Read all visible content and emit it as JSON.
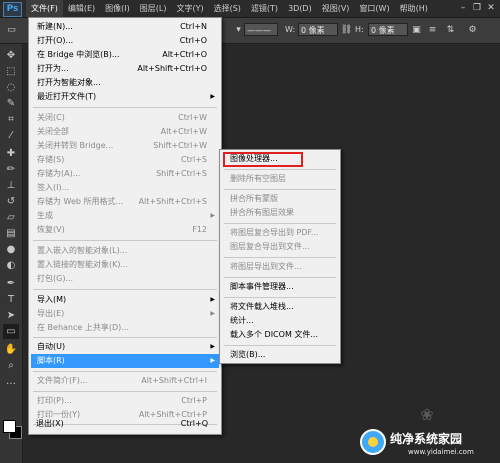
{
  "app": {
    "logo": "Ps"
  },
  "menubar": {
    "items": [
      "文件(F)",
      "编辑(E)",
      "图像(I)",
      "图层(L)",
      "文字(Y)",
      "选择(S)",
      "滤镜(T)",
      "3D(D)",
      "视图(V)",
      "窗口(W)",
      "帮助(H)"
    ],
    "active_index": 0
  },
  "optionsbar": {
    "w_label": "W:",
    "w_value": "0 像素",
    "h_label": "H:",
    "h_value": "0 像素"
  },
  "file_menu": {
    "items": [
      {
        "label": "新建(N)...",
        "shortcut": "Ctrl+N",
        "enabled": true
      },
      {
        "label": "打开(O)...",
        "shortcut": "Ctrl+O",
        "enabled": true
      },
      {
        "label": "在 Bridge 中浏览(B)...",
        "shortcut": "Alt+Ctrl+O",
        "enabled": true
      },
      {
        "label": "打开为...",
        "shortcut": "Alt+Shift+Ctrl+O",
        "enabled": true
      },
      {
        "label": "打开为智能对象...",
        "shortcut": "",
        "enabled": true
      },
      {
        "label": "最近打开文件(T)",
        "shortcut": "",
        "enabled": true,
        "submenu": true
      },
      {
        "label": "关闭(C)",
        "shortcut": "Ctrl+W",
        "enabled": false
      },
      {
        "label": "关闭全部",
        "shortcut": "Alt+Ctrl+W",
        "enabled": false
      },
      {
        "label": "关闭并转到 Bridge...",
        "shortcut": "Shift+Ctrl+W",
        "enabled": false
      },
      {
        "label": "存储(S)",
        "shortcut": "Ctrl+S",
        "enabled": false
      },
      {
        "label": "存储为(A)...",
        "shortcut": "Shift+Ctrl+S",
        "enabled": false
      },
      {
        "label": "签入(I)...",
        "shortcut": "",
        "enabled": false
      },
      {
        "label": "存储为 Web 所用格式...",
        "shortcut": "Alt+Shift+Ctrl+S",
        "enabled": false
      },
      {
        "label": "生成",
        "shortcut": "",
        "enabled": false,
        "submenu": true
      },
      {
        "label": "恢复(V)",
        "shortcut": "F12",
        "enabled": false
      },
      {
        "label": "置入嵌入的智能对象(L)...",
        "shortcut": "",
        "enabled": false
      },
      {
        "label": "置入链接的智能对象(K)...",
        "shortcut": "",
        "enabled": false
      },
      {
        "label": "打包(G)...",
        "shortcut": "",
        "enabled": false
      },
      {
        "label": "导入(M)",
        "shortcut": "",
        "enabled": true,
        "submenu": true
      },
      {
        "label": "导出(E)",
        "shortcut": "",
        "enabled": false,
        "submenu": true
      },
      {
        "label": "在 Behance 上共享(D)...",
        "shortcut": "",
        "enabled": false
      },
      {
        "label": "自动(U)",
        "shortcut": "",
        "enabled": true,
        "submenu": true
      },
      {
        "label": "脚本(R)",
        "shortcut": "",
        "enabled": true,
        "submenu": true,
        "highlighted": true
      },
      {
        "label": "文件简介(F)...",
        "shortcut": "Alt+Shift+Ctrl+I",
        "enabled": false
      },
      {
        "label": "打印(P)...",
        "shortcut": "Ctrl+P",
        "enabled": false
      },
      {
        "label": "打印一份(Y)",
        "shortcut": "Alt+Shift+Ctrl+P",
        "enabled": false
      },
      {
        "label": "退出(X)",
        "shortcut": "Ctrl+Q",
        "enabled": true
      }
    ]
  },
  "scripts_submenu": {
    "items": [
      {
        "label": "图像处理器...",
        "enabled": true
      },
      {
        "label": "删除所有空图层",
        "enabled": false
      },
      {
        "label": "拼合所有蒙版",
        "enabled": false
      },
      {
        "label": "拼合所有图层效果",
        "enabled": false
      },
      {
        "label": "将图层复合导出到 PDF...",
        "enabled": false
      },
      {
        "label": "图层复合导出到文件...",
        "enabled": false
      },
      {
        "label": "将图层导出到文件...",
        "enabled": false
      },
      {
        "label": "脚本事件管理器...",
        "enabled": true
      },
      {
        "label": "将文件载入堆栈...",
        "enabled": true
      },
      {
        "label": "统计...",
        "enabled": true
      },
      {
        "label": "载入多个 DICOM 文件...",
        "enabled": true
      },
      {
        "label": "浏览(B)...",
        "enabled": true
      }
    ]
  },
  "watermark": {
    "title": "纯净系统家园",
    "url": "www.yidaimei.com"
  },
  "colors": {
    "highlight": "#3399ff",
    "annotation_box": "#e02020",
    "menu_bg": "#f0f0f0"
  }
}
